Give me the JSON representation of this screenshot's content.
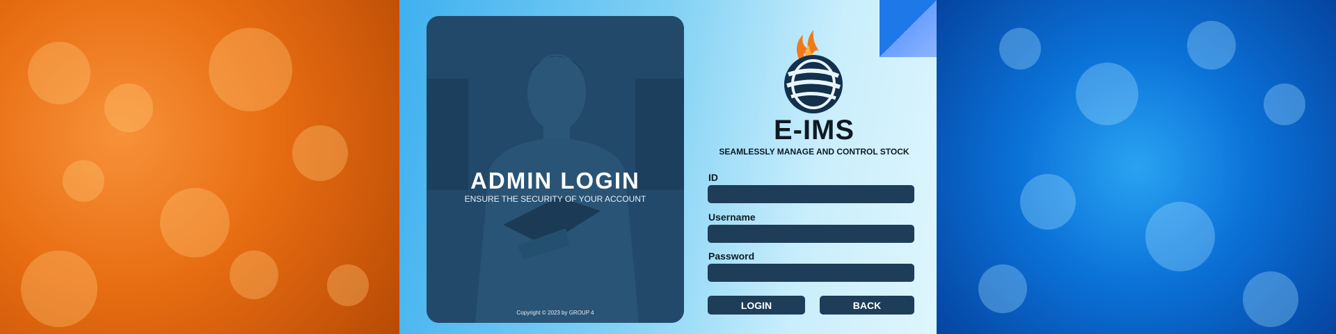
{
  "colors": {
    "left_bg": "#e86d12",
    "right_bg": "#0b72d8",
    "panel": "#1e3d58",
    "text_dark": "#0f1a24"
  },
  "hero": {
    "title": "ADMIN LOGIN",
    "subtitle": "ENSURE THE SECURITY OF YOUR ACCOUNT",
    "copyright": "Copyright © 2023 by GROUP 4"
  },
  "brand": {
    "name": "E-IMS",
    "tagline": "SEAMLESSLY MANAGE AND CONTROL STOCK",
    "logo_icon": "globe-flame-logo"
  },
  "form": {
    "id_label": "ID",
    "id_value": "",
    "username_label": "Username",
    "username_value": "",
    "password_label": "Password",
    "password_value": ""
  },
  "buttons": {
    "login": "LOGIN",
    "back": "BACK"
  }
}
